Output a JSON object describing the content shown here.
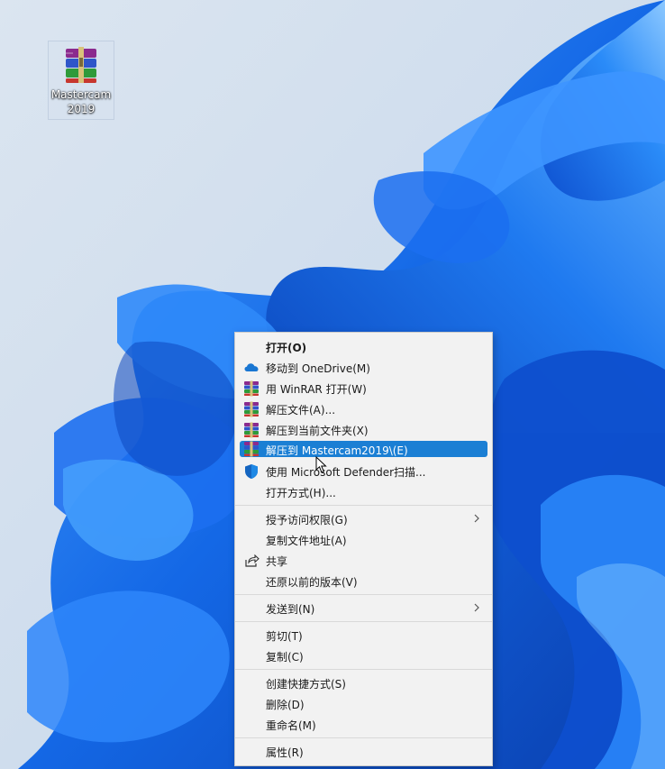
{
  "desktop": {
    "icon_label": "Mastercam2019",
    "icon_type": "winrar-archive-icon"
  },
  "context_menu": {
    "items": [
      {
        "label": "打开(O)",
        "icon": "",
        "bold": true
      },
      {
        "label": "移动到 OneDrive(M)",
        "icon": "onedrive-cloud-icon"
      },
      {
        "label": "用 WinRAR 打开(W)",
        "icon": "winrar-icon"
      },
      {
        "label": "解压文件(A)...",
        "icon": "winrar-icon"
      },
      {
        "label": "解压到当前文件夹(X)",
        "icon": "winrar-icon"
      },
      {
        "label": "解压到 Mastercam2019\\(E)",
        "icon": "winrar-icon",
        "highlighted": true
      },
      {
        "label": "使用 Microsoft Defender扫描...",
        "icon": "defender-shield-icon"
      },
      {
        "label": "打开方式(H)...",
        "icon": ""
      },
      {
        "label": "授予访问权限(G)",
        "icon": "",
        "submenu": true
      },
      {
        "label": "复制文件地址(A)",
        "icon": ""
      },
      {
        "label": "共享",
        "icon": "share-icon"
      },
      {
        "label": "还原以前的版本(V)",
        "icon": ""
      },
      {
        "label": "发送到(N)",
        "icon": "",
        "submenu": true
      },
      {
        "label": "剪切(T)",
        "icon": ""
      },
      {
        "label": "复制(C)",
        "icon": ""
      },
      {
        "label": "创建快捷方式(S)",
        "icon": ""
      },
      {
        "label": "删除(D)",
        "icon": ""
      },
      {
        "label": "重命名(M)",
        "icon": ""
      },
      {
        "label": "属性(R)",
        "icon": ""
      }
    ]
  },
  "colors": {
    "highlight": "#1b7fd4",
    "menu_background": "#f2f2f2",
    "wallpaper_blue": "#1a6ae8"
  }
}
